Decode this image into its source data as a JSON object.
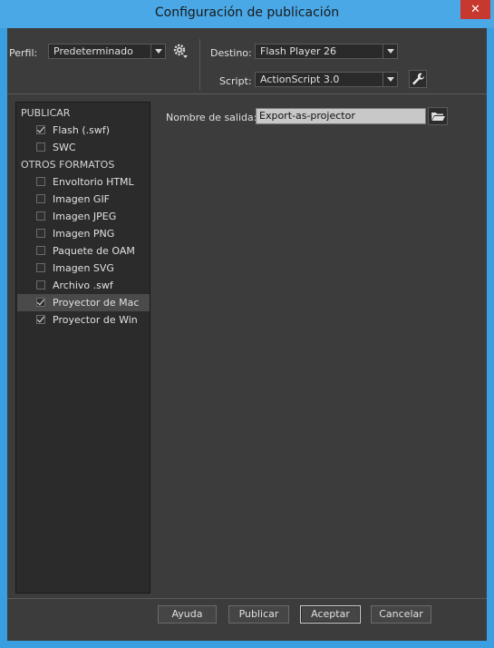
{
  "window": {
    "title": "Configuración de publicación",
    "close_glyph": "✕"
  },
  "profile": {
    "label": "Perfil:",
    "value": "Predeterminado"
  },
  "target": {
    "label": "Destino:",
    "value": "Flash Player 26"
  },
  "script": {
    "label": "Script:",
    "value": "ActionScript 3.0"
  },
  "sidebar": {
    "publish_title": "PUBLICAR",
    "publish_items": [
      {
        "label": "Flash (.swf)",
        "checked": true
      },
      {
        "label": "SWC",
        "checked": false
      }
    ],
    "other_title": "OTROS FORMATOS",
    "other_items": [
      {
        "label": "Envoltorio HTML",
        "checked": false
      },
      {
        "label": "Imagen GIF",
        "checked": false
      },
      {
        "label": "Imagen JPEG",
        "checked": false
      },
      {
        "label": "Imagen PNG",
        "checked": false
      },
      {
        "label": "Paquete de OAM",
        "checked": false
      },
      {
        "label": "Imagen SVG",
        "checked": false
      },
      {
        "label": "Archivo .swf",
        "checked": false
      },
      {
        "label": "Proyector de Mac",
        "checked": true,
        "selected": true
      },
      {
        "label": "Proyector de Win",
        "checked": true
      }
    ]
  },
  "output": {
    "label": "Nombre de salida:",
    "value": "Export-as-projector"
  },
  "buttons": {
    "help": "Ayuda",
    "publish": "Publicar",
    "ok": "Aceptar",
    "cancel": "Cancelar"
  },
  "colors": {
    "titlebar": "#4aa8e6",
    "client_bg": "#3c3c3c",
    "panel_bg": "#2b2b2b",
    "close": "#c7382e"
  }
}
